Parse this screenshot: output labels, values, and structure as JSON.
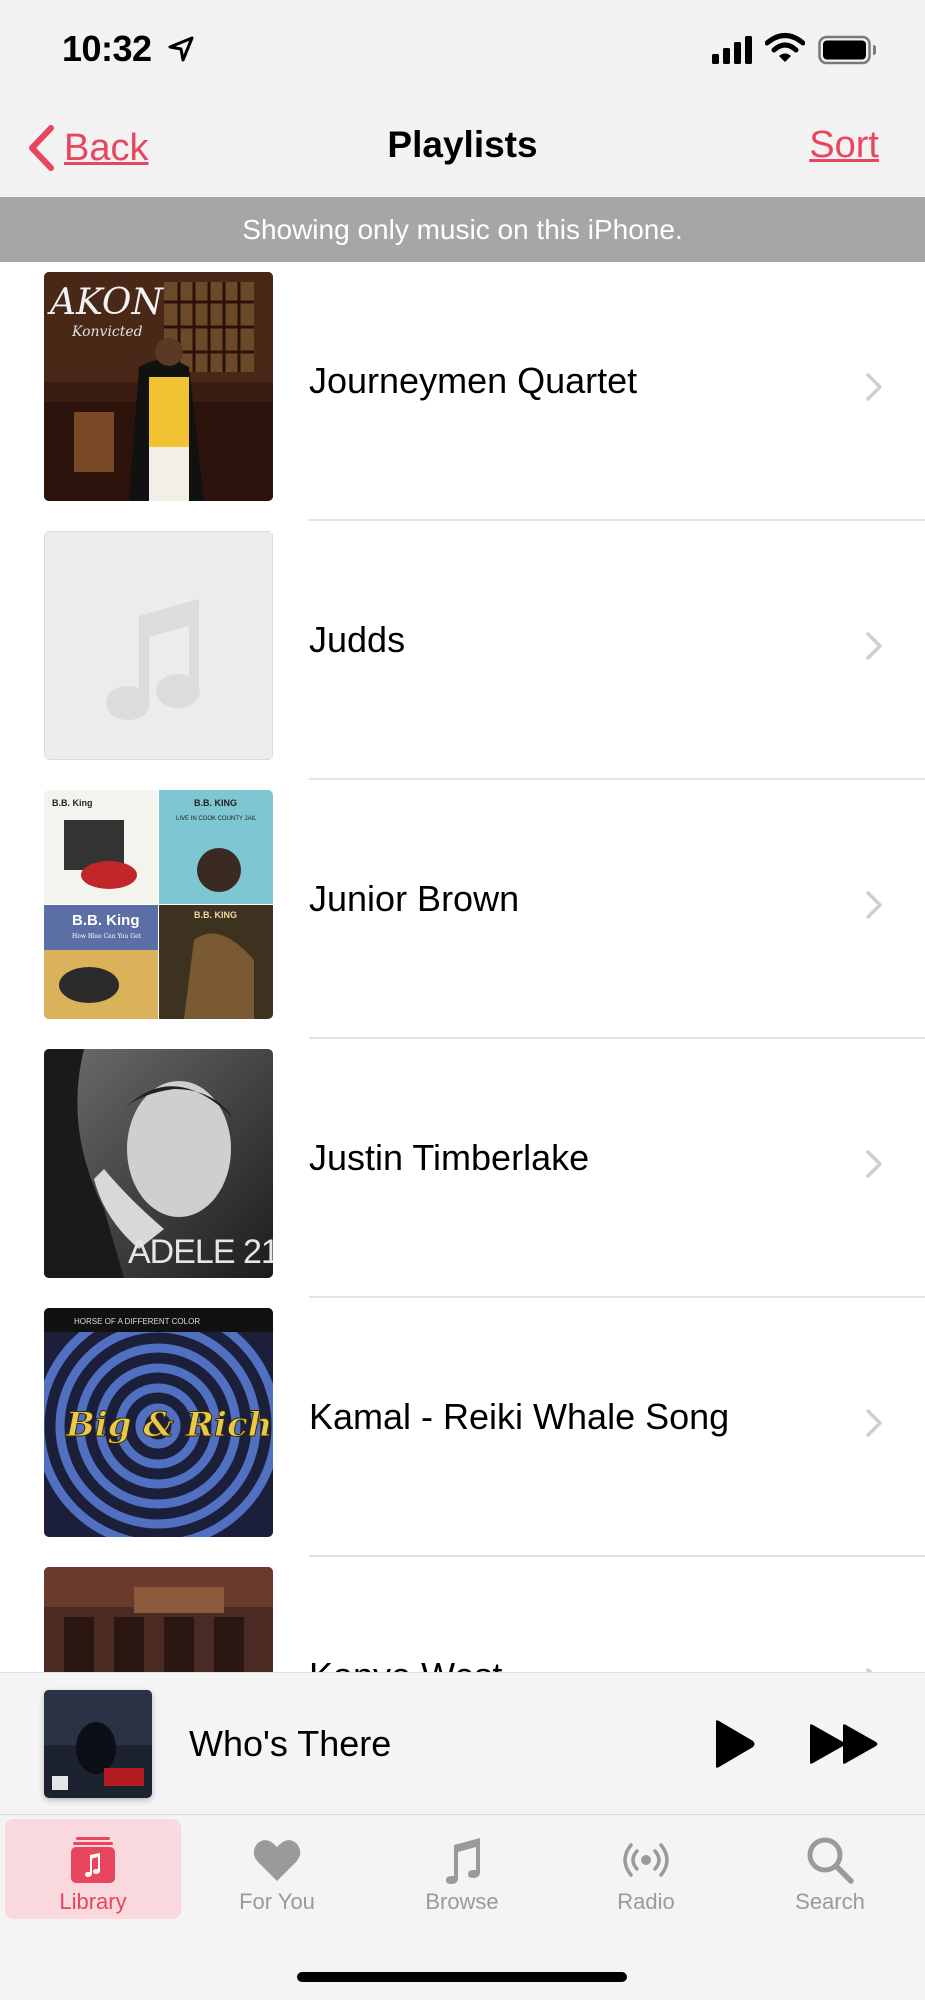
{
  "status_bar": {
    "time": "10:32"
  },
  "nav": {
    "back_label": "Back",
    "title": "Playlists",
    "sort_label": "Sort"
  },
  "banner": {
    "text": "Showing only music on this iPhone."
  },
  "playlists": [
    {
      "label": "Journeymen Quartet",
      "art": "akon-art"
    },
    {
      "label": "Judds",
      "art": "placeholder-note-art"
    },
    {
      "label": "Junior Brown",
      "art": "bb-king-mosaic-art"
    },
    {
      "label": "Justin Timberlake",
      "art": "adele-art"
    },
    {
      "label": "Kamal - Reiki Whale Song",
      "art": "big-rich-art"
    },
    {
      "label": "Kanye West",
      "art": "building-art"
    }
  ],
  "artwork_text": {
    "akon_title": "AKON",
    "akon_subtitle": "Konvicted",
    "bbking_1": "B.B. King",
    "bbking_2": "B.B. KING",
    "bbking_3": "B.B. King",
    "bbking_4": "B.B. KING",
    "bbking_sub_2": "LIVE IN COOK COUNTY JAIL",
    "bbking_sub_3": "How Blue Can You Get",
    "adele": "ADELE 21",
    "bigrich_top": "HORSE OF A DIFFERENT COLOR",
    "bigrich": "Big & Rich"
  },
  "now_playing": {
    "title": "Who's There"
  },
  "tabs": [
    {
      "label": "Library",
      "icon": "library-icon",
      "active": true
    },
    {
      "label": "For You",
      "icon": "heart-icon",
      "active": false
    },
    {
      "label": "Browse",
      "icon": "music-note-icon",
      "active": false
    },
    {
      "label": "Radio",
      "icon": "radio-icon",
      "active": false
    },
    {
      "label": "Search",
      "icon": "search-icon",
      "active": false
    }
  ],
  "colors": {
    "accent": "#e8465f",
    "banner": "#a6a6a6",
    "bar_bg": "#f2f2f2",
    "inactive_tab": "#9a9a9a"
  }
}
